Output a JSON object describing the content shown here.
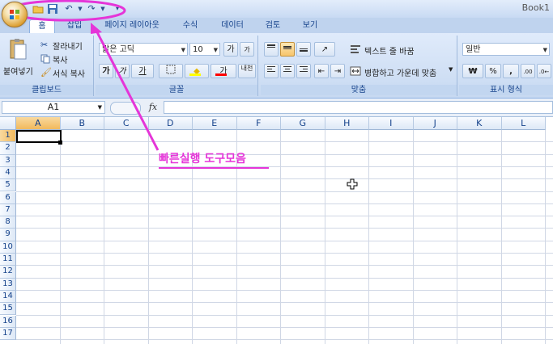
{
  "window": {
    "title": "Book1"
  },
  "quick_access": {
    "undo_icon": "undo-icon",
    "redo_icon": "redo-icon"
  },
  "tabs": [
    "홈",
    "삽입",
    "페이지 레이아웃",
    "수식",
    "데이터",
    "검토",
    "보기"
  ],
  "clipboard": {
    "paste": "붙여넣기",
    "cut": "잘라내기",
    "copy": "복사",
    "format_painter": "서식 복사",
    "label": "클립보드"
  },
  "font": {
    "name": "맑은 고딕",
    "size": "10",
    "grow": "가",
    "shrink": "가",
    "bold": "가",
    "italic": "가",
    "underline": "가",
    "font_color": "가",
    "phonetic": "내천",
    "label": "글꼴"
  },
  "alignment": {
    "wrap_text": "텍스트 줄 바꿈",
    "merge_center": "병합하고 가운데 맞춤",
    "label": "맞춤"
  },
  "number": {
    "format": "일반",
    "currency": "₩",
    "percent": "%",
    "comma": ",",
    "inc_decimal": ".00",
    "label": "표시 형식"
  },
  "formula_bar": {
    "name_box": "A1",
    "fx": "fx"
  },
  "columns": [
    "A",
    "B",
    "C",
    "D",
    "E",
    "F",
    "G",
    "H",
    "I",
    "J",
    "K",
    "L"
  ],
  "rows": [
    "1",
    "2",
    "3",
    "4",
    "5",
    "6",
    "7",
    "8",
    "9",
    "10",
    "11",
    "12",
    "13",
    "14",
    "15",
    "16",
    "17"
  ],
  "annotation": {
    "text": "빠른실행 도구모음",
    "color": "#e535d8"
  },
  "colors": {
    "accent": "#15428b",
    "annotation": "#e535d8",
    "selection": "#f1b95c"
  }
}
